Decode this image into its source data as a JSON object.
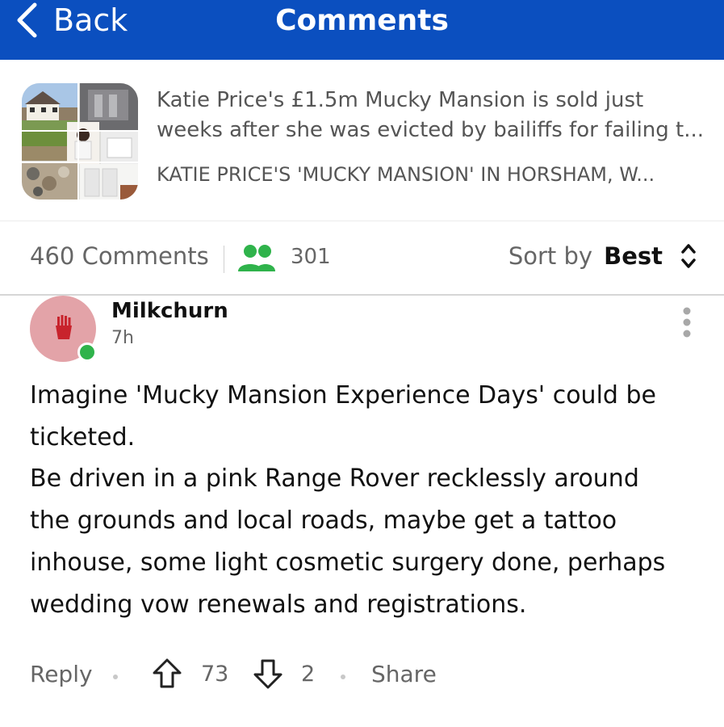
{
  "header": {
    "back_label": "Back",
    "title": "Comments",
    "background_color": "#0b4fbf"
  },
  "article": {
    "thumbnail_icon": "article-collage-thumbnail",
    "title": "Katie Price's £1.5m Mucky Mansion is sold just weeks after she was evicted by bailiffs for failing t...",
    "source": "KATIE PRICE'S 'MUCKY MANSION' IN HORSHAM, W..."
  },
  "stats": {
    "comment_count": "460 Comments",
    "people_icon": "people-icon",
    "people_count": "301",
    "people_icon_color": "#2fb34b",
    "sort_label": "Sort by",
    "sort_value": "Best"
  },
  "comment": {
    "avatar_icon": "fries-icon",
    "avatar_color": "#e3a3a8",
    "online_color": "#2fb34b",
    "username": "Milkchurn",
    "time": "7h",
    "body_lines": [
      "Imagine 'Mucky Mansion Experience Days' could be",
      "ticketed.",
      "Be driven in a pink Range Rover recklessly around",
      "the grounds and local roads, maybe get a tattoo",
      "inhouse, some light cosmetic surgery done, perhaps",
      "wedding vow renewals and registrations."
    ],
    "reply_label": "Reply",
    "upvotes": "73",
    "downvotes": "2",
    "share_label": "Share"
  }
}
